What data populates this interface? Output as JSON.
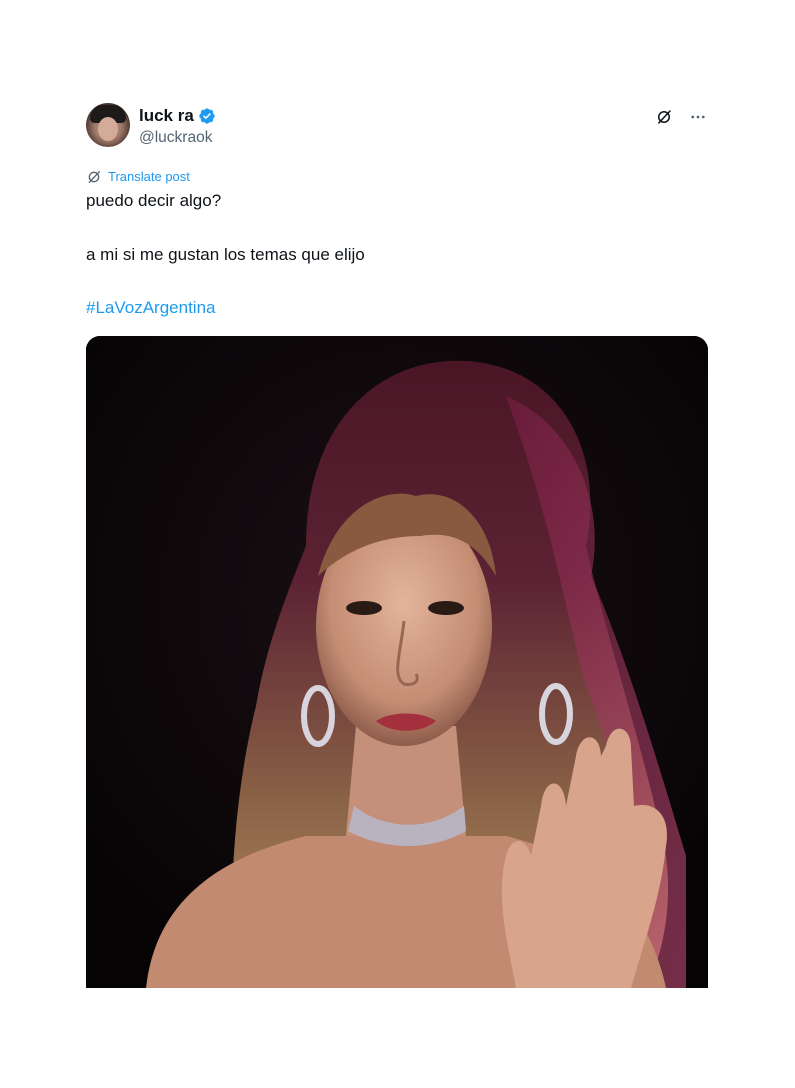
{
  "author": {
    "display_name": "luck ra",
    "handle": "@luckraok",
    "verified": true
  },
  "icons": {
    "verified": "verified-badge-icon",
    "grok": "grok-icon",
    "more": "more-options-icon",
    "translate": "translate-icon"
  },
  "colors": {
    "link": "#1d9bf0",
    "verified": "#1d9bf0",
    "secondary_text": "#536471",
    "text": "#0f1419"
  },
  "translate_label": "Translate post",
  "body": {
    "line_1": "puedo decir algo?",
    "line_2": "a mi si me gustan los temas que elijo",
    "hashtag": "#LaVozArgentina"
  },
  "media": {
    "type": "photo"
  }
}
